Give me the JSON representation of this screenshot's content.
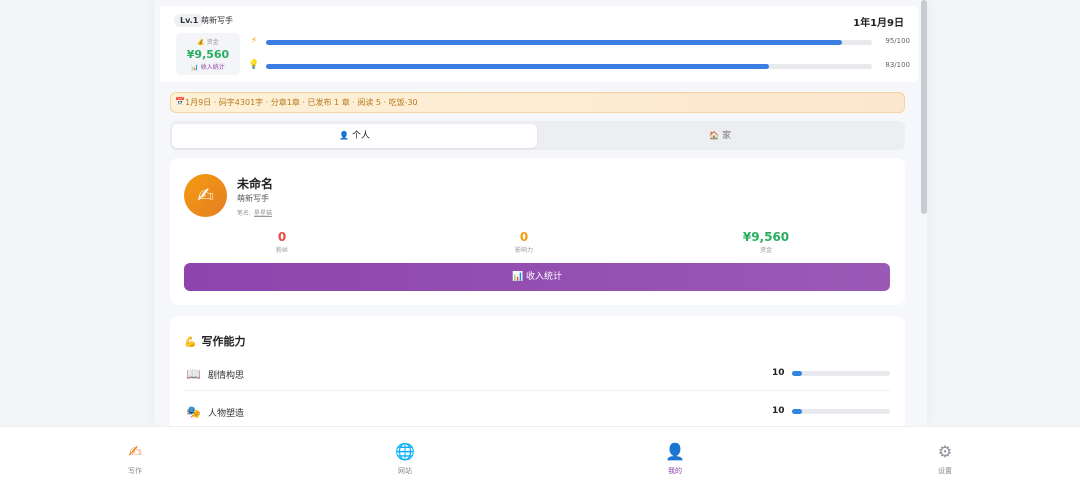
{
  "header": {
    "level": "Lv.1",
    "rank": "萌新写手",
    "date": "1年1月9日",
    "money_label": "资金",
    "money_value": "¥9,560",
    "money_sub": "收入统计",
    "stats": [
      {
        "icon": "energy-icon",
        "glyph": "⚡",
        "label": "95/100",
        "value": 95,
        "max": 100
      },
      {
        "icon": "idea-icon",
        "glyph": "💡",
        "label": "83/100",
        "value": 83,
        "max": 100
      }
    ]
  },
  "notice": {
    "text": "1月9日 · 码字4301字 · 分章1章 · 已发布 1 章 · 阅读 5 · 吃饭-30"
  },
  "tabs": [
    {
      "label": "个人",
      "icon": "person-icon",
      "glyph": "👤",
      "active": true
    },
    {
      "label": "家",
      "icon": "house-icon",
      "glyph": "🏠",
      "active": false
    }
  ],
  "profile": {
    "name": "未命名",
    "rank": "萌新写手",
    "pen_label": "笔名:",
    "pen_value": "星星猫",
    "stats": [
      {
        "value": "0",
        "label": "粉丝",
        "color": "#e74c3c"
      },
      {
        "value": "0",
        "label": "影响力",
        "color": "#f39c12"
      },
      {
        "value": "¥9,560",
        "label": "资金",
        "color": "#27ae60"
      }
    ],
    "income_button": "收入统计"
  },
  "abilities": {
    "title": "写作能力",
    "items": [
      {
        "label": "剧情构思",
        "value": "10",
        "icon": "book-icon",
        "glyph": "📖",
        "fraction": 0.1
      },
      {
        "label": "人物塑造",
        "value": "10",
        "icon": "masks-icon",
        "glyph": "🎭",
        "fraction": 0.1
      }
    ]
  },
  "nav": [
    {
      "label": "写作",
      "icon": "pen-icon",
      "glyph": "✍",
      "active": false
    },
    {
      "label": "网站",
      "icon": "globe-icon",
      "glyph": "🌐",
      "active": false
    },
    {
      "label": "我的",
      "icon": "user-icon",
      "glyph": "👤",
      "active": true
    },
    {
      "label": "设置",
      "icon": "gear-icon",
      "glyph": "⚙",
      "active": false
    }
  ],
  "colors": {
    "accent": "#8e44ad",
    "progress": "#3b7de0",
    "money": "#27ae60"
  }
}
